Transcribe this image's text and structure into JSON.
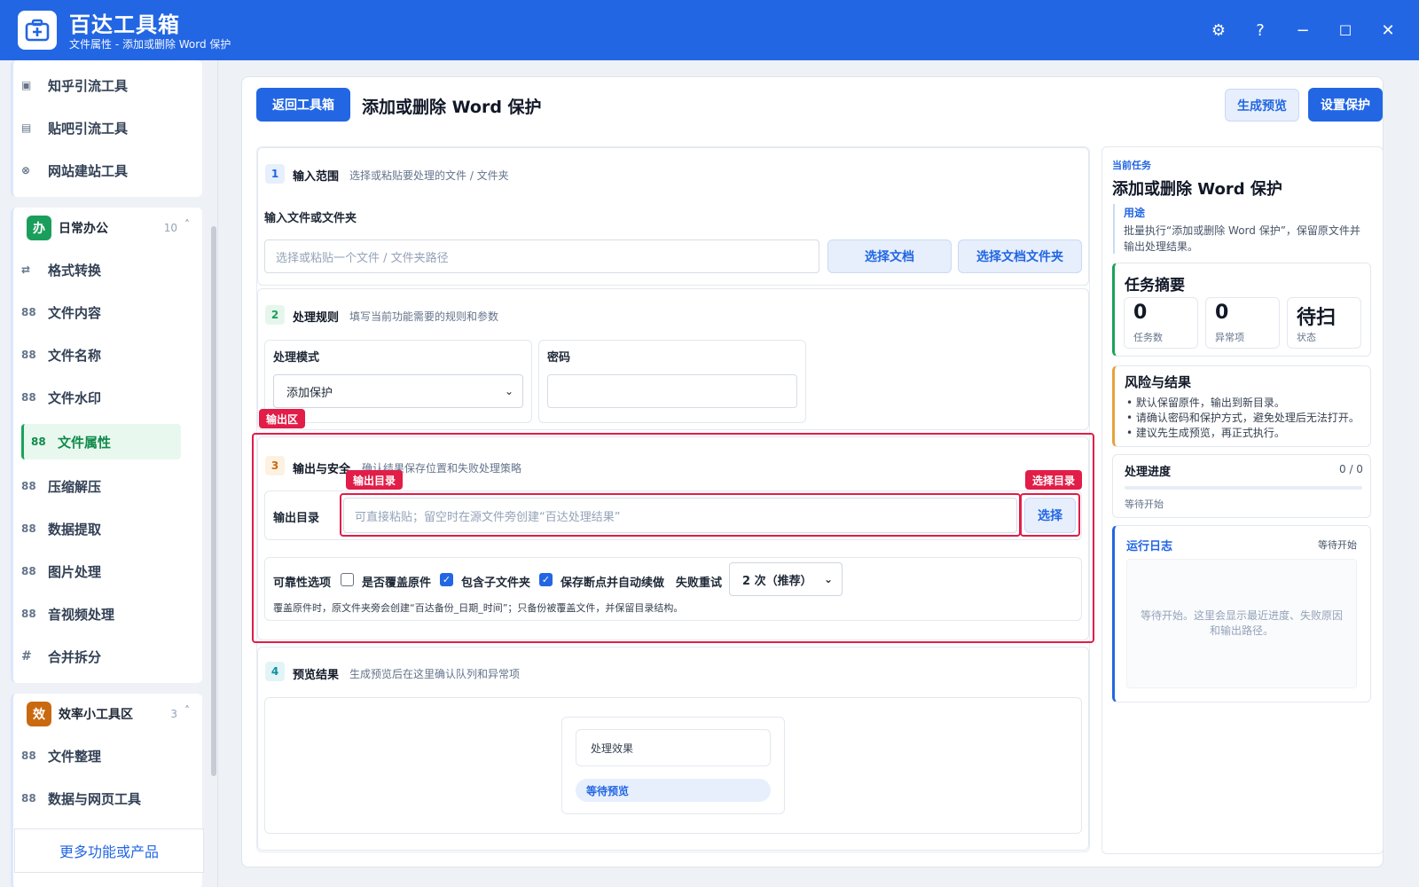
{
  "app": {
    "title": "百达工具箱",
    "subtitle": "文件属性 - 添加或删除 Word 保护"
  },
  "window": {
    "settings": "⚙",
    "help": "?",
    "minimize": "−",
    "maximize": "☐",
    "close": "✕"
  },
  "sidebar": {
    "top_items": [
      {
        "label": "知乎引流工具",
        "icon": "▣"
      },
      {
        "label": "贴吧引流工具",
        "icon": "▤"
      },
      {
        "label": "网站建站工具",
        "icon": "⊗"
      }
    ],
    "groups": [
      {
        "badge": "办",
        "badge_color": "#1a9e5c",
        "title": "日常办公",
        "count": "10",
        "caret": "˄",
        "items": [
          {
            "label": "格式转换",
            "icon": "⇄"
          },
          {
            "label": "文件内容",
            "icon": "88"
          },
          {
            "label": "文件名称",
            "icon": "88"
          },
          {
            "label": "文件水印",
            "icon": "88"
          },
          {
            "label": "文件属性",
            "icon": "88",
            "active": true
          },
          {
            "label": "压缩解压",
            "icon": "88"
          },
          {
            "label": "数据提取",
            "icon": "88"
          },
          {
            "label": "图片处理",
            "icon": "88"
          },
          {
            "label": "音视频处理",
            "icon": "88"
          },
          {
            "label": "合并拆分",
            "icon": "#"
          }
        ]
      },
      {
        "badge": "效",
        "badge_color": "#c96a10",
        "title": "效率小工具区",
        "count": "3",
        "caret": "˄",
        "items": [
          {
            "label": "文件整理",
            "icon": "88"
          },
          {
            "label": "数据与网页工具",
            "icon": "88"
          }
        ]
      }
    ],
    "more": "更多功能或产品"
  },
  "header": {
    "back": "返回工具箱",
    "title": "添加或删除 Word 保护",
    "preview": "生成预览",
    "apply": "设置保护"
  },
  "sections": {
    "s1": {
      "num": "1",
      "title": "输入范围",
      "desc": "选择或粘贴要处理的文件 / 文件夹",
      "field_label": "输入文件或文件夹",
      "placeholder": "选择或粘贴一个文件 / 文件夹路径",
      "btn_doc": "选择文档",
      "btn_folder": "选择文档文件夹"
    },
    "s2": {
      "num": "2",
      "title": "处理规则",
      "desc": "填写当前功能需要的规则和参数",
      "mode_label": "处理模式",
      "mode_value": "添加保护",
      "pwd_label": "密码",
      "pwd_value": ""
    },
    "s3": {
      "num": "3",
      "title": "输出与安全",
      "desc": "确认结果保存位置和失败处理策略",
      "out_label": "输出目录",
      "out_placeholder": "可直接粘贴；留空时在源文件旁创建“百达处理结果”",
      "out_btn": "选择",
      "opt_label": "可靠性选项",
      "opt_overwrite": "是否覆盖原件",
      "opt_sub": "包含子文件夹",
      "opt_resume": "保存断点并自动续做",
      "retry_label": "失败重试",
      "retry_value": "2 次（推荐）",
      "note": "覆盖原件时，原文件夹旁会创建“百达备份_日期_时间”；只备份被覆盖文件，并保留目录结构。"
    },
    "s4": {
      "num": "4",
      "title": "预览结果",
      "desc": "生成预览后在这里确认队列和异常项",
      "effect": "处理效果",
      "status": "等待预览"
    }
  },
  "annotations": {
    "output_area": "输出区",
    "output_dir": "输出目录",
    "choose_dir": "选择目录"
  },
  "right": {
    "kicker": "当前任务",
    "title": "添加或删除 Word 保护",
    "use_label": "用途",
    "use_text": "批量执行“添加或删除 Word 保护”，保留原文件并输出处理结果。",
    "summary_title": "任务摘要",
    "stats": [
      {
        "value": "0",
        "label": "任务数"
      },
      {
        "value": "0",
        "label": "异常项"
      },
      {
        "value": "待扫",
        "label": "状态"
      }
    ],
    "risk_title": "风险与结果",
    "risks": [
      "默认保留原件，输出到新目录。",
      "请确认密码和保护方式，避免处理后无法打开。",
      "建议先生成预览，再正式执行。"
    ],
    "progress_title": "处理进度",
    "progress_count": "0 / 0",
    "progress_value": 0,
    "progress_status": "等待开始",
    "log_title": "运行日志",
    "log_status": "等待开始",
    "log_text": "等待开始。这里会显示最近进度、失败原因和输出路径。"
  },
  "colors": {
    "accent": "#2266e3",
    "danger": "#e11d48",
    "success": "#1aa35a",
    "warning": "#e6a23c"
  }
}
